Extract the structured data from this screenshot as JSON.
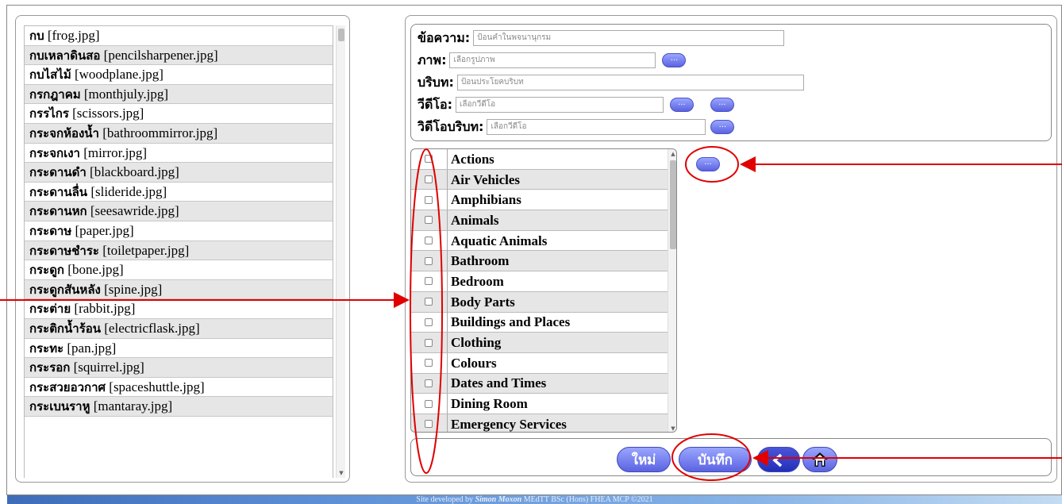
{
  "word_list": {
    "items": [
      {
        "th": "กบ",
        "file": "[frog.jpg]"
      },
      {
        "th": "กบเหลาดินสอ",
        "file": "[pencilsharpener.jpg]"
      },
      {
        "th": "กบไสไม้",
        "file": "[woodplane.jpg]"
      },
      {
        "th": "กรกฎาคม",
        "file": "[monthjuly.jpg]"
      },
      {
        "th": "กรรไกร",
        "file": "[scissors.jpg]"
      },
      {
        "th": "กระจกห้องน้ำ",
        "file": "[bathroommirror.jpg]"
      },
      {
        "th": "กระจกเงา",
        "file": "[mirror.jpg]"
      },
      {
        "th": "กระดานดำ",
        "file": "[blackboard.jpg]"
      },
      {
        "th": "กระดานลื่น",
        "file": "[slideride.jpg]"
      },
      {
        "th": "กระดานหก",
        "file": "[seesawride.jpg]"
      },
      {
        "th": "กระดาษ",
        "file": "[paper.jpg]"
      },
      {
        "th": "กระดาษชำระ",
        "file": "[toiletpaper.jpg]"
      },
      {
        "th": "กระดูก",
        "file": "[bone.jpg]"
      },
      {
        "th": "กระดูกสันหลัง",
        "file": "[spine.jpg]"
      },
      {
        "th": "กระต่าย",
        "file": "[rabbit.jpg]"
      },
      {
        "th": "กระติกน้ำร้อน",
        "file": "[electricflask.jpg]"
      },
      {
        "th": "กระทะ",
        "file": "[pan.jpg]"
      },
      {
        "th": "กระรอก",
        "file": "[squirrel.jpg]"
      },
      {
        "th": "กระสวยอวกาศ",
        "file": "[spaceshuttle.jpg]"
      },
      {
        "th": "กระเบนราหู",
        "file": "[mantaray.jpg]"
      }
    ]
  },
  "form": {
    "message": {
      "label": "ข้อความ:",
      "placeholder": "ป้อนคำในพจนานุกรม"
    },
    "image": {
      "label": "ภาพ:",
      "placeholder": "เลือกรูปภาพ",
      "button": "..."
    },
    "context": {
      "label": "บริบท:",
      "placeholder": "ป้อนประโยคบริบท"
    },
    "video": {
      "label": "วีดีโอ:",
      "placeholder": "เลือกวีดีโอ",
      "button1": "...",
      "button2": "..."
    },
    "context_video": {
      "label": "วิดีโอบริบท:",
      "placeholder": "เลือกวีดีโอ",
      "button": "..."
    }
  },
  "categories": {
    "items": [
      "Actions",
      "Air Vehicles",
      "Amphibians",
      "Animals",
      "Aquatic Animals",
      "Bathroom",
      "Bedroom",
      "Body Parts",
      "Buildings and Places",
      "Clothing",
      "Colours",
      "Dates and Times",
      "Dining Room",
      "Emergency Services"
    ],
    "add_button": "..."
  },
  "buttons": {
    "new": "ใหม่",
    "save": "บันทึก"
  },
  "icons": {
    "back": "back-arrow-icon",
    "home": "home-icon"
  },
  "footer": {
    "prefix": "Site developed by",
    "author": "Simon Moxon",
    "credentials": "MEdTT BSc (Hons) FHEA MCP ©2021"
  },
  "colors": {
    "button_light": "#9aa6ff",
    "button_dark": "#5b63e0",
    "annotation_red": "#e00000",
    "footer_blue": "#3e6cb8"
  }
}
